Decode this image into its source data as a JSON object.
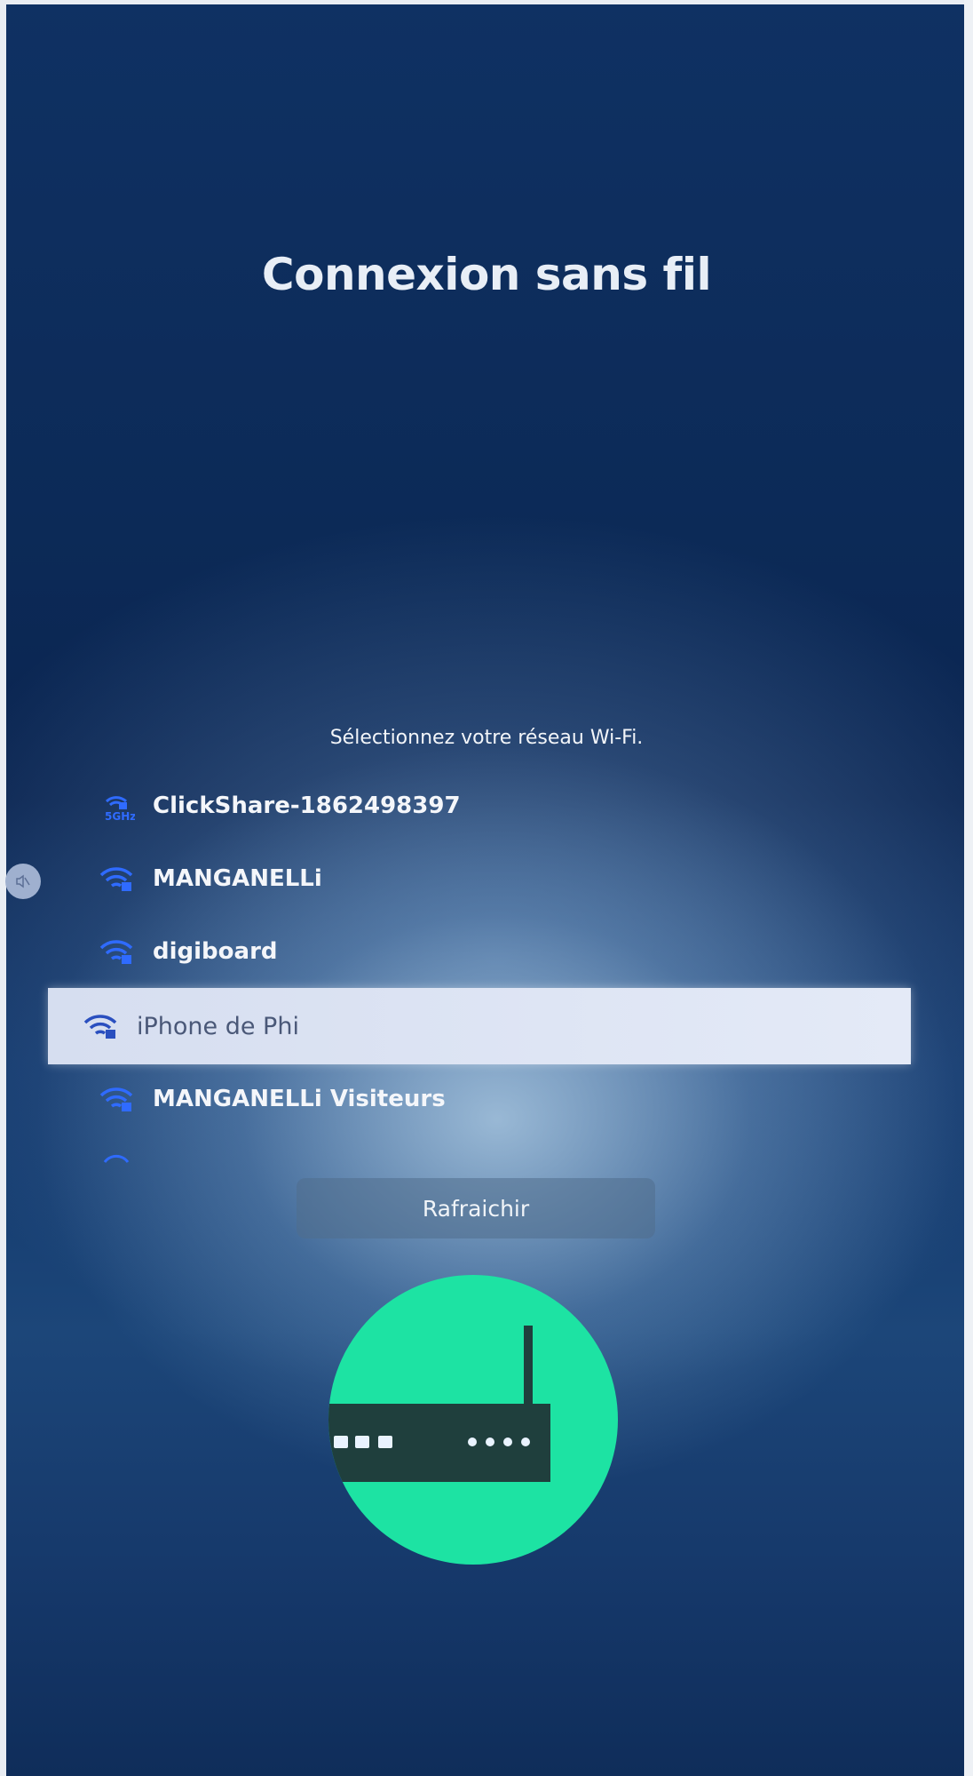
{
  "screen": {
    "title": "Connexion sans fil",
    "subtitle": "Sélectionnez votre réseau Wi-Fi."
  },
  "networks": [
    {
      "ssid": "ClickShare-1862498397",
      "band": "5GHz",
      "icon": "wifi-5ghz-lock-icon",
      "selected": false
    },
    {
      "ssid": "MANGANELLi",
      "icon": "wifi-lock-icon",
      "selected": false
    },
    {
      "ssid": "digiboard",
      "icon": "wifi-lock-icon",
      "selected": false
    },
    {
      "ssid": "iPhone de Phi",
      "icon": "wifi-lock-icon",
      "selected": true
    },
    {
      "ssid": "MANGANELLi Visiteurs",
      "icon": "wifi-lock-icon",
      "selected": false
    }
  ],
  "actions": {
    "refresh_label": "Rafraichir"
  },
  "side": {
    "mute_icon": "mute-icon"
  },
  "illustration": {
    "icon": "router-icon"
  },
  "colors": {
    "accent_wifi": "#2f6bff",
    "illustration_green": "#1de3a3",
    "selected_bg": "#dce3f3"
  }
}
